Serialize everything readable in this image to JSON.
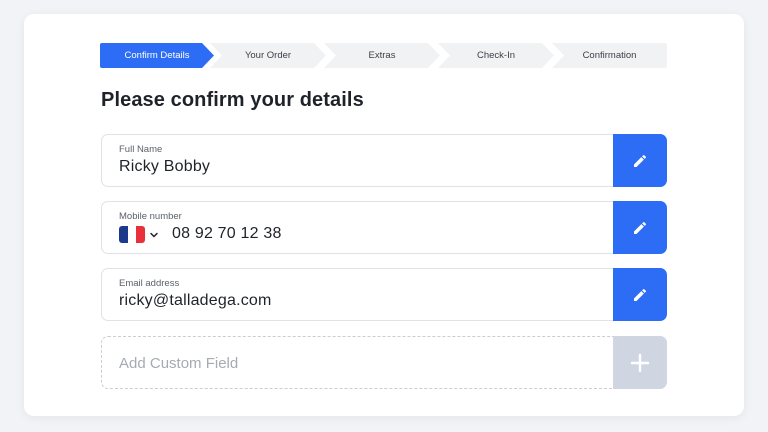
{
  "steps": [
    {
      "label": "Confirm Details",
      "active": true
    },
    {
      "label": "Your Order",
      "active": false
    },
    {
      "label": "Extras",
      "active": false
    },
    {
      "label": "Check-In",
      "active": false
    },
    {
      "label": "Confirmation",
      "active": false
    }
  ],
  "heading": "Please confirm your details",
  "fields": {
    "full_name": {
      "label": "Full Name",
      "value": "Ricky Bobby",
      "edit_icon": "pencil-icon"
    },
    "mobile": {
      "label": "Mobile number",
      "country_flag": "france-flag-icon",
      "dropdown_icon": "chevron-down-icon",
      "value": "08 92 70 12 38",
      "edit_icon": "pencil-icon"
    },
    "email": {
      "label": "Email address",
      "value": "ricky@talladega.com",
      "edit_icon": "pencil-icon"
    }
  },
  "custom_field": {
    "placeholder": "Add Custom Field",
    "add_icon": "plus-icon"
  },
  "colors": {
    "accent": "#2d6df6",
    "disabled_button": "#cfd6e2",
    "step_inactive": "#f1f2f4"
  }
}
